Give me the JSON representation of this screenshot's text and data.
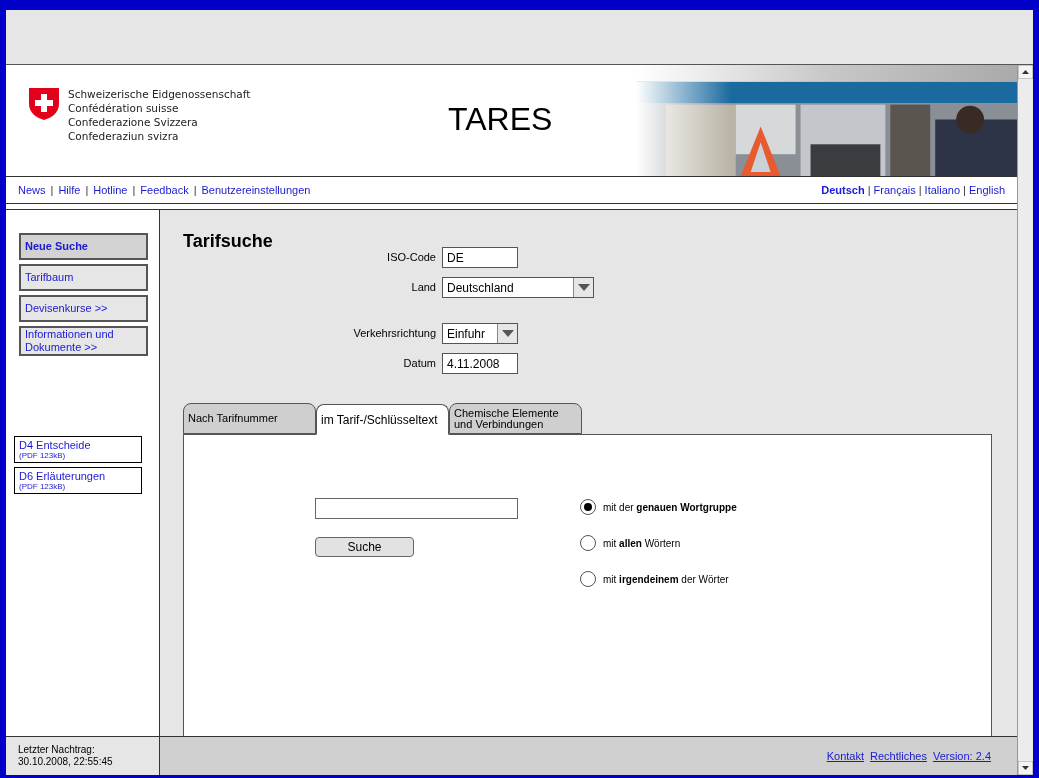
{
  "header": {
    "confederation": [
      "Schweizerische Eidgenossenschaft",
      "Confédération suisse",
      "Confederazione Svizzera",
      "Confederaziun svizra"
    ],
    "title": "TARES"
  },
  "nav": {
    "links": [
      {
        "label": "News"
      },
      {
        "label": "Hilfe"
      },
      {
        "label": "Hotline"
      },
      {
        "label": "Feedback"
      },
      {
        "label": "Benutzereinstellungen"
      }
    ],
    "separators": [
      "|",
      "|",
      "|",
      "|"
    ]
  },
  "languages": {
    "items": [
      {
        "label": "Deutsch",
        "selected": true
      },
      {
        "label": "Français",
        "selected": false
      },
      {
        "label": "Italiano",
        "selected": false
      },
      {
        "label": "English",
        "selected": false
      }
    ],
    "separators": [
      "|",
      "|",
      "|"
    ]
  },
  "sidebar": {
    "items": [
      {
        "label": "Neue Suche",
        "selected": true
      },
      {
        "label": "Tarifbaum",
        "selected": false
      },
      {
        "label": "Devisenkurse >>",
        "selected": false
      },
      {
        "label": "Informationen und Dokumente >>",
        "selected": false
      }
    ],
    "documents": [
      {
        "label": "D4 Entscheide",
        "size": "(PDF 123kB)"
      },
      {
        "label": "D6 Erläuterungen",
        "size": "(PDF 123kB)"
      }
    ]
  },
  "page_title": "Tarifsuche",
  "form": [
    {
      "kind": "text",
      "label": "ISO-Code",
      "value": "DE"
    },
    {
      "kind": "select",
      "label": "Land",
      "value": "Deutschland"
    },
    {
      "kind": "select",
      "label": "Verkehrsrichtung",
      "value": "Einfuhr"
    },
    {
      "kind": "text",
      "label": "Datum",
      "value": "4.11.2008"
    }
  ],
  "tabs": [
    {
      "label": "Nach Tarifnummer",
      "selected": false
    },
    {
      "label": "im Tarif-/Schlüsseltext",
      "selected": true
    },
    {
      "label": "Chemische Elemente und Verbindungen",
      "selected": false
    }
  ],
  "search": {
    "button": "Suche"
  },
  "options": [
    {
      "label": "mit der **genauen Wortgruppe**",
      "selected": true
    },
    {
      "label": "mit **allen** Wörtern",
      "selected": false
    },
    {
      "label": "mit **irgendeinem** der Wörter",
      "selected": false
    }
  ],
  "footer": {
    "last_update": [
      "Letzter Nachtrag:",
      "30.10.2008, 22:55:45"
    ],
    "links": [
      "Kontakt",
      "Rechtliches",
      "Version: 2.4"
    ]
  }
}
